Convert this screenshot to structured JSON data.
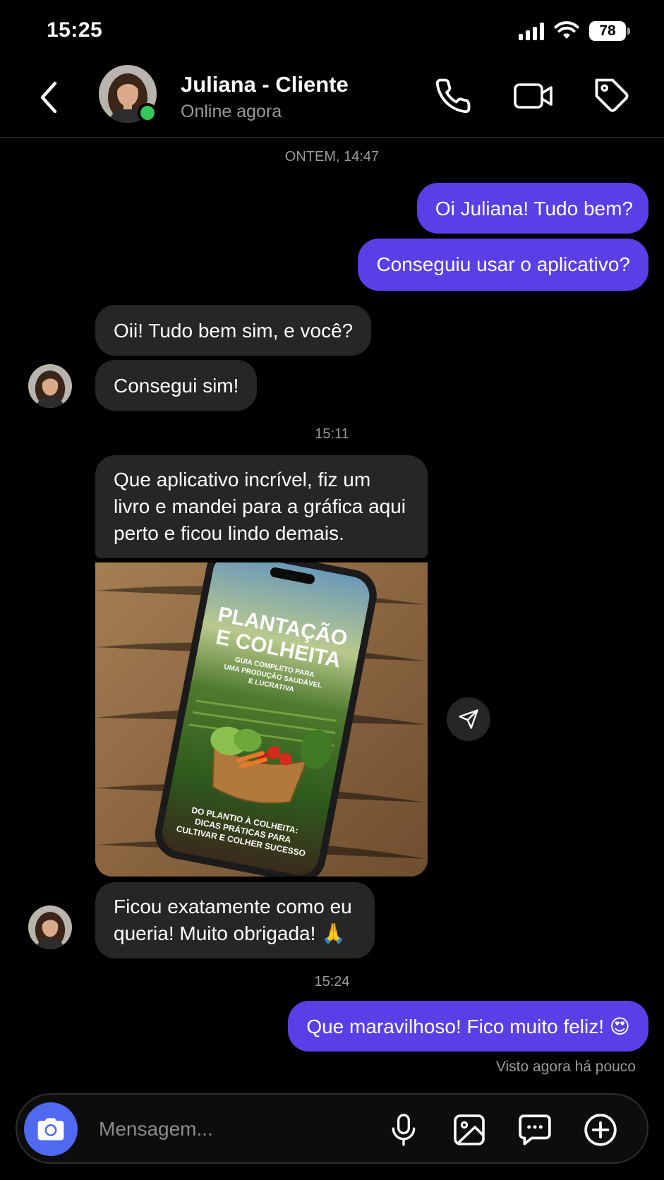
{
  "status_bar": {
    "time": "15:25",
    "battery": "78"
  },
  "header": {
    "name": "Juliana - Cliente",
    "status": "Online agora"
  },
  "chat": {
    "timestamps": [
      "ONTEM, 14:47",
      "15:11",
      "15:24"
    ],
    "messages": [
      {
        "from": "me",
        "text": "Oi Juliana! Tudo bem?"
      },
      {
        "from": "me",
        "text": "Conseguiu usar o aplicativo?"
      },
      {
        "from": "contact",
        "text": "Oii! Tudo bem sim, e você?"
      },
      {
        "from": "contact",
        "text": "Consegui sim!"
      },
      {
        "from": "contact",
        "text": "Que aplicativo incrível, fiz um livro e mandei para a gráfica aqui perto e ficou lindo demais."
      },
      {
        "from": "contact",
        "text": "Ficou exatamente como eu queria! Muito obrigada! 🙏"
      },
      {
        "from": "me",
        "text": "Que maravilhoso! Fico muito feliz! 😍"
      }
    ],
    "photo": {
      "title_line1": "PLANTAÇÃO",
      "title_line2": "E COLHEITA",
      "subtitle_line1": "GUIA COMPLETO PARA",
      "subtitle_line2": "UMA PRODUÇÃO SAUDÁVEL",
      "subtitle_line3": "E LUCRATIVA",
      "footer_line1": "DO PLANTIO À COLHEITA:",
      "footer_line2": "DICAS PRÁTICAS PARA",
      "footer_line3": "CULTIVAR E COLHER SUCESSO"
    },
    "seen": "Visto agora há pouco"
  },
  "composer": {
    "placeholder": "Mensagem..."
  },
  "icons": {
    "back": "chevron-left-icon",
    "call": "phone-icon",
    "video": "video-camera-icon",
    "tag": "tag-icon",
    "camera": "camera-icon",
    "mic": "microphone-icon",
    "gallery": "image-icon",
    "sticker": "chat-bubble-icon",
    "more": "plus-circle-icon",
    "share": "send-icon"
  },
  "colors": {
    "accent": "#5b3fe6",
    "incoming": "#262626",
    "online": "#34c759",
    "camera": "#4f69f0"
  }
}
